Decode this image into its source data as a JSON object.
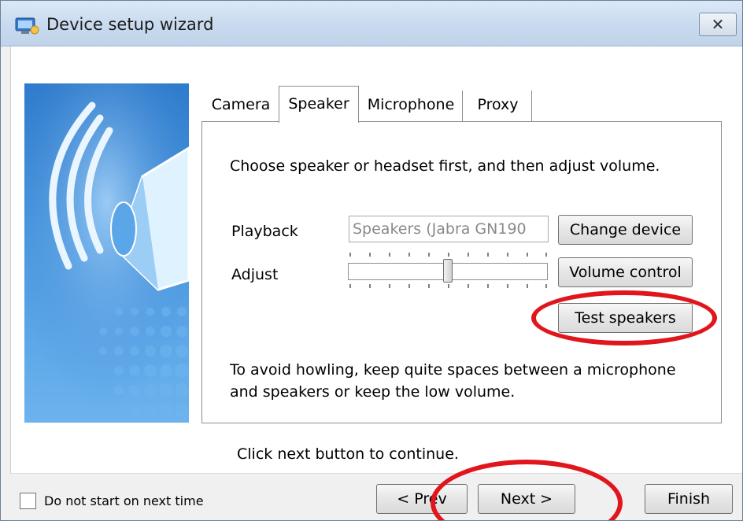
{
  "window": {
    "title": "Device setup wizard",
    "close_label": "✕"
  },
  "tabs": [
    {
      "label": "Camera",
      "selected": false
    },
    {
      "label": "Speaker",
      "selected": true
    },
    {
      "label": "Microphone",
      "selected": false
    },
    {
      "label": "Proxy",
      "selected": false
    }
  ],
  "speaker_page": {
    "instruction": "Choose speaker or headset first, and then adjust volume.",
    "playback_label": "Playback",
    "playback_device": "Speakers (Jabra GN190",
    "change_device_label": "Change device",
    "adjust_label": "Adjust",
    "volume_level": 0.5,
    "volume_control_label": "Volume control",
    "test_speakers_label": "Test speakers",
    "note": "To avoid howling, keep quite spaces between a microphone and speakers or keep the low volume."
  },
  "continue_text": "Click next button to continue.",
  "footer": {
    "checkbox_label": "Do not start on next time",
    "checkbox_checked": false,
    "prev_label": "< Prev",
    "next_label": "Next >",
    "finish_label": "Finish"
  },
  "colors": {
    "annotation": "#e0161c",
    "banner_blue": "#3f8bd8",
    "titlebar": "#c9daef"
  },
  "icons": {
    "app": "device-wizard-icon",
    "banner": "speaker-megaphone-icon"
  }
}
